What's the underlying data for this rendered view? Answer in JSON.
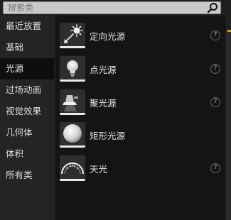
{
  "search": {
    "placeholder": "搜索类",
    "value": ""
  },
  "sidebar": {
    "items": [
      {
        "label": "最近放置",
        "active": false
      },
      {
        "label": "基础",
        "active": false
      },
      {
        "label": "光源",
        "active": true
      },
      {
        "label": "过场动画",
        "active": false
      },
      {
        "label": "视觉效果",
        "active": false
      },
      {
        "label": "几何体",
        "active": false
      },
      {
        "label": "体积",
        "active": false
      },
      {
        "label": "所有类",
        "active": false
      }
    ]
  },
  "content": {
    "items": [
      {
        "label": "定向光源",
        "icon": "directional-light-icon",
        "help": "?"
      },
      {
        "label": "点光源",
        "icon": "point-light-icon",
        "help": "?"
      },
      {
        "label": "聚光源",
        "icon": "spot-light-icon",
        "help": "?"
      },
      {
        "label": "矩形光源",
        "icon": "rect-light-icon",
        "help": null
      },
      {
        "label": "天光",
        "icon": "sky-light-icon",
        "help": "?"
      }
    ]
  },
  "colors": {
    "accent": "#d4a017",
    "active_bg": "#0e0e0e"
  }
}
